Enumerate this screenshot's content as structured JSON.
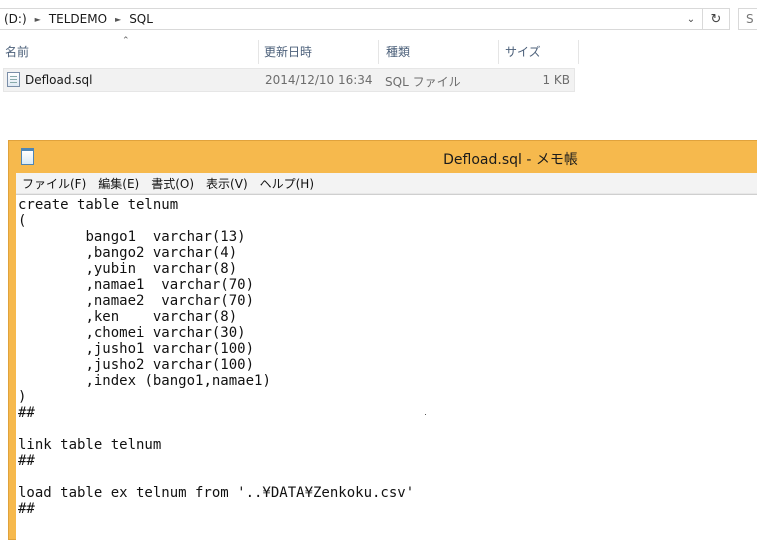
{
  "explorer": {
    "breadcrumb": [
      "(D:)",
      "TELDEMO",
      "SQL"
    ],
    "search_placeholder": "S",
    "columns": {
      "name": "名前",
      "modified": "更新日時",
      "type": "種類",
      "size": "サイズ"
    },
    "files": [
      {
        "name": "Defload.sql",
        "modified": "2014/12/10 16:34",
        "type": "SQL ファイル",
        "size": "1 KB"
      }
    ]
  },
  "notepad": {
    "title": "Defload.sql - メモ帳",
    "menu": [
      "ファイル(F)",
      "編集(E)",
      "書式(O)",
      "表示(V)",
      "ヘルプ(H)"
    ],
    "content": "create table telnum\n(\n\tbango1  varchar(13)\n\t,bango2 varchar(4)\n\t,yubin  varchar(8)\n\t,namae1  varchar(70)\n\t,namae2  varchar(70)\n\t,ken    varchar(8)\n\t,chomei varchar(30)\n\t,jusho1 varchar(100)\n\t,jusho2 varchar(100)\n\t,index (bango1,namae1)\n)\n##\n\nlink table telnum\n##\n\nload table ex telnum from '..¥DATA¥Zenkoku.csv'\n##"
  }
}
